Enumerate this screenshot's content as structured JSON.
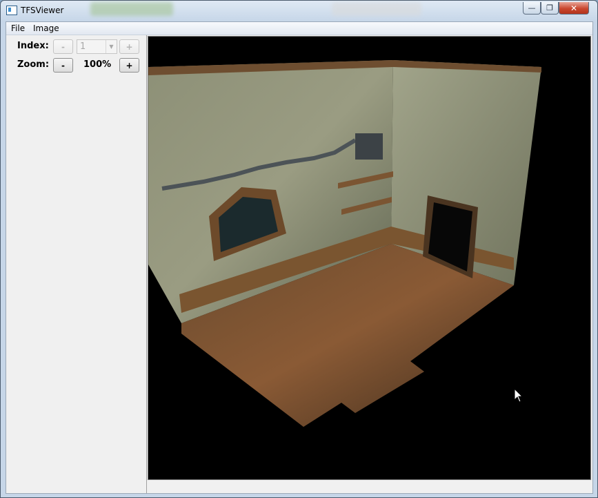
{
  "window": {
    "title": "TFSViewer"
  },
  "title_controls": {
    "minimize": "—",
    "maximize": "❐",
    "close": "✕"
  },
  "menu": {
    "items": [
      "File",
      "Image"
    ]
  },
  "controls": {
    "index_label": "Index:",
    "index_minus": "-",
    "index_value": "1",
    "index_plus": "+",
    "zoom_label": "Zoom:",
    "zoom_minus": "-",
    "zoom_value": "100%",
    "zoom_plus": "+"
  },
  "image": {
    "description_icon": "isometric-room-render"
  },
  "colors": {
    "accent": "#3c8fd0",
    "close": "#c9472f",
    "viewer_bg": "#000000"
  }
}
